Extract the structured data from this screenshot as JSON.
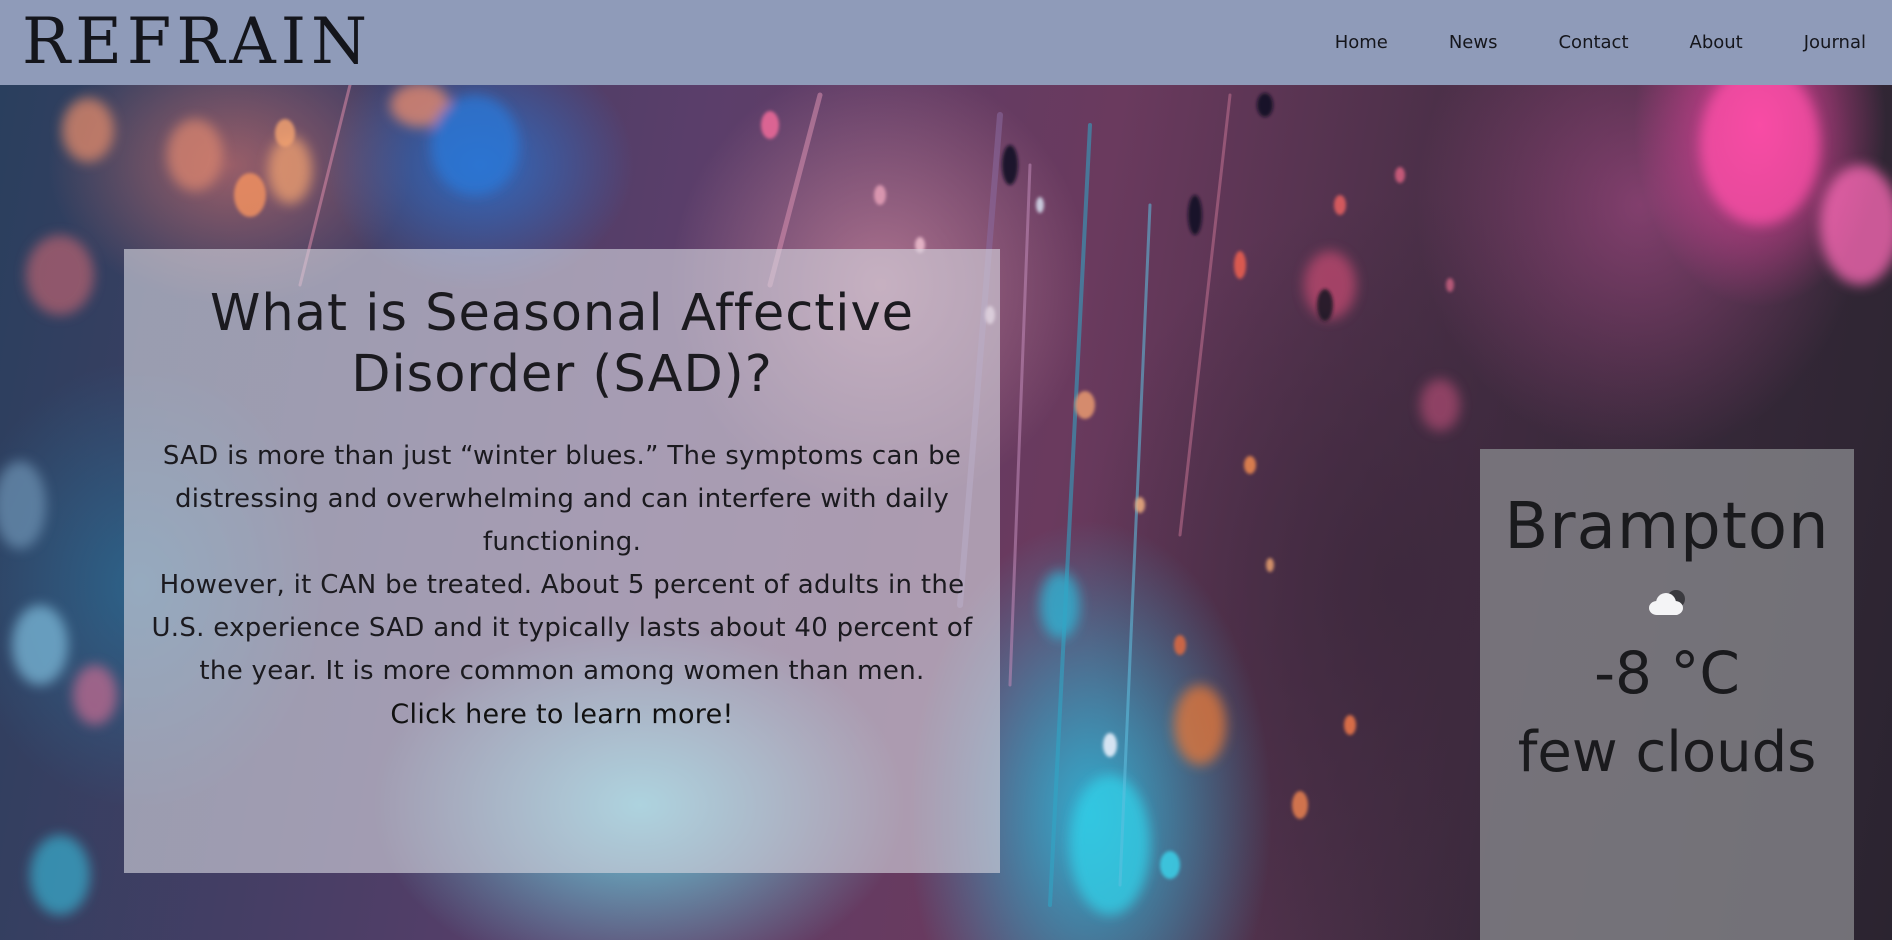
{
  "header": {
    "logo": "REFRAIN",
    "nav": [
      "Home",
      "News",
      "Contact",
      "About",
      "Journal"
    ]
  },
  "info": {
    "title": "What is Seasonal Affective Disorder (SAD)?",
    "paragraph1": "SAD is more than just “winter blues.” The symptoms can be distressing and overwhelming and can interfere with daily functioning.",
    "paragraph2": "However, it CAN be treated. About 5 percent of adults in the U.S. experience SAD and it typically lasts about 40 percent of the year. It is more common among women than men.",
    "link": "Click here to learn more!"
  },
  "weather": {
    "city": "Brampton",
    "icon": "few-clouds-icon",
    "temperature": "-8 °C",
    "description": "few clouds"
  },
  "colors": {
    "header_bg": "#8f9bb9",
    "text": "#1b1a1f",
    "info_panel": "rgba(215,215,225,0.62)",
    "weather_panel": "rgba(130,130,135,0.82)"
  }
}
